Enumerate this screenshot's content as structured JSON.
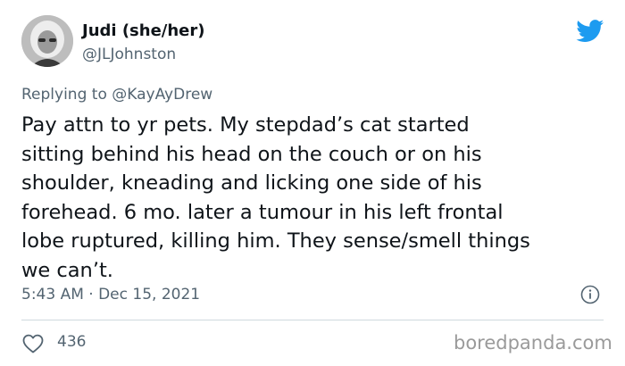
{
  "author": {
    "display_name": "Judi (she/her)",
    "handle": "@JLJohnston"
  },
  "reply": {
    "prefix": "Replying to ",
    "mention": "@KayAyDrew"
  },
  "tweet": {
    "text": "Pay attn to yr pets. My stepdad’s cat started\nsitting behind his head on the couch or on his\nshoulder, kneading and licking one side of his\nforehead. 6 mo. later a tumour in his left frontal\nlobe ruptured, killing him. They sense/smell things\nwe can’t.",
    "timestamp": "5:43 AM · Dec 15, 2021"
  },
  "engagement": {
    "likes": "436"
  },
  "watermark": "boredpanda.com",
  "icons": {
    "brand": "twitter-bird-icon",
    "info": "info-icon",
    "like": "heart-icon"
  },
  "colors": {
    "brand_blue": "#1d9bf0",
    "secondary_text": "#536471",
    "primary_text": "#0f1419",
    "divider": "#cfd9de"
  }
}
